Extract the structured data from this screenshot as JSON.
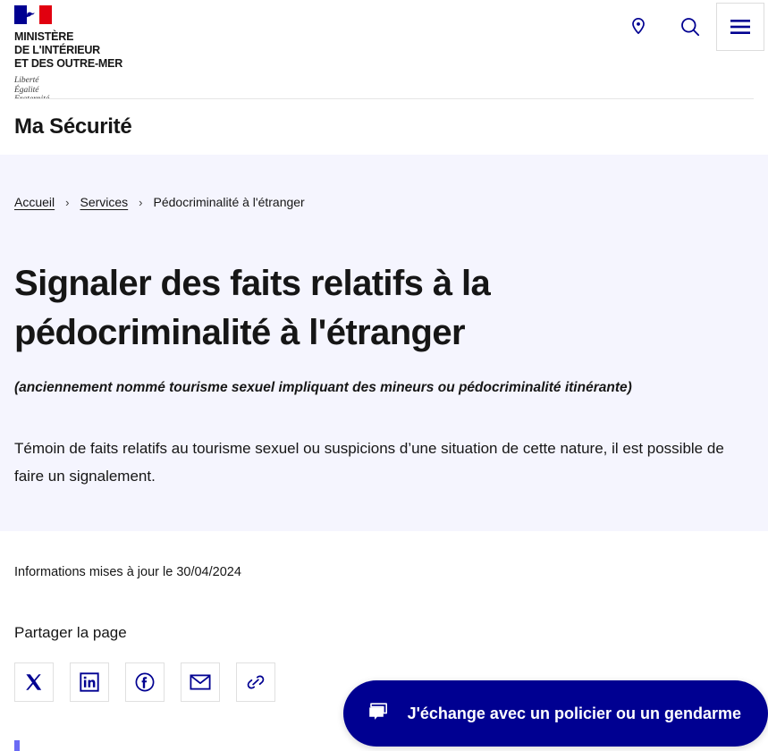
{
  "header": {
    "logo": {
      "flag_icon": "french-flag-icon",
      "flag_colors": {
        "blue": "#000091",
        "white": "#ffffff",
        "red": "#e1000f"
      },
      "ministry": "MINISTÈRE\nDE L'INTÉRIEUR\nET DES OUTRE-MER",
      "motto": "Liberté\nÉgalité\nFraternité"
    },
    "tools": [
      {
        "name": "location-icon",
        "label": "Localisation"
      },
      {
        "name": "search-icon",
        "label": "Rechercher"
      },
      {
        "name": "menu-icon",
        "label": "Menu"
      }
    ]
  },
  "site": {
    "title": "Ma Sécurité"
  },
  "breadcrumb": {
    "items": [
      {
        "label": "Accueil",
        "link": true
      },
      {
        "label": "Services",
        "link": true
      },
      {
        "label": "Pédocriminalité à l'étranger",
        "link": false
      }
    ],
    "separator": "›"
  },
  "hero": {
    "background": "#f5f5fe",
    "title": "Signaler des faits relatifs à la pédocriminalité à l'étranger",
    "subtitle": "(anciennement nommé tourisme sexuel impliquant des mineurs ou pédocriminalité itinérante)",
    "body": "Témoin de faits relatifs au tourisme sexuel ou suspicions d’une situation de cette nature, il est possible de faire un signalement."
  },
  "meta": {
    "updated": "Informations mises à jour le 30/04/2024"
  },
  "share": {
    "label": "Partager la page",
    "buttons": [
      {
        "name": "share-x-button",
        "icon": "x-twitter-icon",
        "label": "X"
      },
      {
        "name": "share-linkedin-button",
        "icon": "linkedin-icon",
        "label": "LinkedIn"
      },
      {
        "name": "share-facebook-button",
        "icon": "facebook-icon",
        "label": "Facebook"
      },
      {
        "name": "share-email-button",
        "icon": "mail-icon",
        "label": "E-mail"
      },
      {
        "name": "share-copy-link-button",
        "icon": "link-icon",
        "label": "Copier le lien"
      }
    ]
  },
  "chat": {
    "label": "J'échange avec un policier ou un gendarme",
    "icon": "chat-bubbles-icon",
    "background": "#000091",
    "text_color": "#ffffff"
  },
  "colors": {
    "brand_blue": "#000091",
    "brand_red": "#e1000f",
    "hero_bg": "#f5f5fe",
    "text": "#161616",
    "accent_violet": "#6a6af4"
  }
}
